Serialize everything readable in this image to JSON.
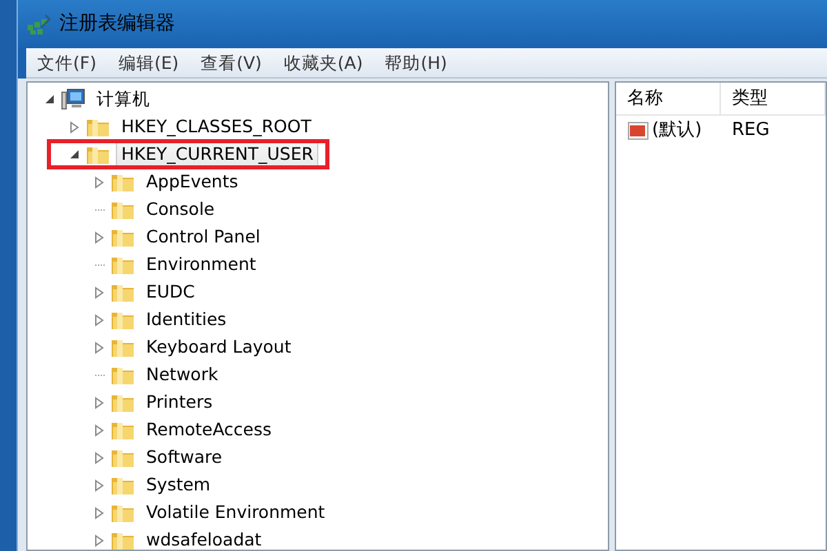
{
  "window": {
    "title": "注册表编辑器"
  },
  "menu": [
    "文件(F)",
    "编辑(E)",
    "查看(V)",
    "收藏夹(A)",
    "帮助(H)"
  ],
  "tree": [
    {
      "label": "计算机",
      "kind": "computer",
      "expandable": true,
      "expanded": true,
      "selected": false,
      "children": [
        {
          "label": "HKEY_CLASSES_ROOT",
          "kind": "folder",
          "expandable": true,
          "expanded": false,
          "selected": false
        },
        {
          "label": "HKEY_CURRENT_USER",
          "kind": "folder",
          "expandable": true,
          "expanded": true,
          "selected": true,
          "highlighted": true,
          "children": [
            {
              "label": "AppEvents",
              "kind": "folder",
              "expandable": true,
              "expanded": false,
              "selected": false
            },
            {
              "label": "Console",
              "kind": "folder",
              "expandable": false,
              "expanded": false,
              "selected": false
            },
            {
              "label": "Control Panel",
              "kind": "folder",
              "expandable": true,
              "expanded": false,
              "selected": false
            },
            {
              "label": "Environment",
              "kind": "folder",
              "expandable": false,
              "expanded": false,
              "selected": false
            },
            {
              "label": "EUDC",
              "kind": "folder",
              "expandable": true,
              "expanded": false,
              "selected": false
            },
            {
              "label": "Identities",
              "kind": "folder",
              "expandable": true,
              "expanded": false,
              "selected": false
            },
            {
              "label": "Keyboard Layout",
              "kind": "folder",
              "expandable": true,
              "expanded": false,
              "selected": false
            },
            {
              "label": "Network",
              "kind": "folder",
              "expandable": false,
              "expanded": false,
              "selected": false
            },
            {
              "label": "Printers",
              "kind": "folder",
              "expandable": true,
              "expanded": false,
              "selected": false
            },
            {
              "label": "RemoteAccess",
              "kind": "folder",
              "expandable": true,
              "expanded": false,
              "selected": false
            },
            {
              "label": "Software",
              "kind": "folder",
              "expandable": true,
              "expanded": false,
              "selected": false
            },
            {
              "label": "System",
              "kind": "folder",
              "expandable": true,
              "expanded": false,
              "selected": false
            },
            {
              "label": "Volatile Environment",
              "kind": "folder",
              "expandable": true,
              "expanded": false,
              "selected": false
            },
            {
              "label": "wdsafeloadat",
              "kind": "folder",
              "expandable": true,
              "expanded": false,
              "selected": false
            }
          ]
        }
      ]
    }
  ],
  "values": {
    "columns": [
      "名称",
      "类型"
    ],
    "rows": [
      {
        "name": "(默认)",
        "type": "REG"
      }
    ]
  }
}
